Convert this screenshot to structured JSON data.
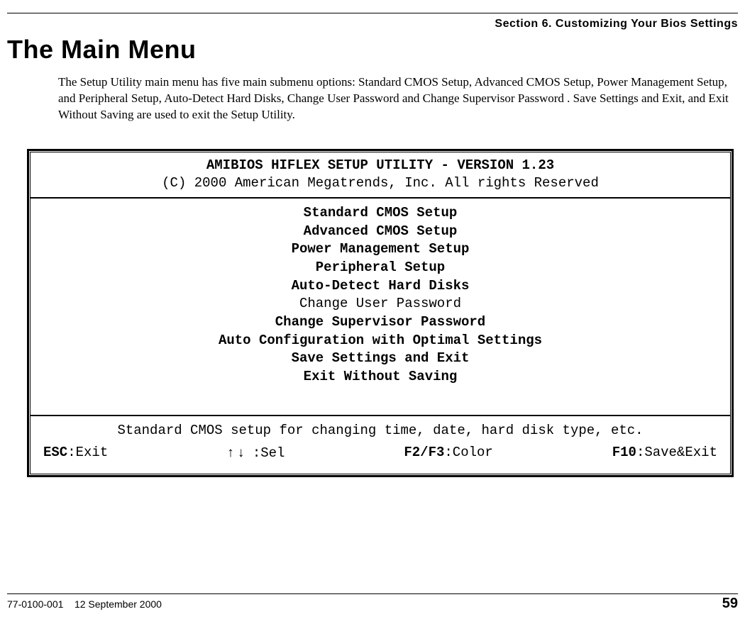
{
  "header": {
    "section": "Section 6. Customizing Your Bios Settings",
    "title": "The Main Menu",
    "intro": "The Setup Utility main menu has five main submenu options: Standard CMOS Setup, Advanced CMOS Setup, Power Management Setup, and Peripheral Setup, Auto-Detect Hard Disks, Change User Password and Change Supervisor Password . Save Settings and Exit, and Exit Without Saving are used to exit the Setup Utility."
  },
  "bios": {
    "title": "AMIBIOS HIFLEX SETUP UTILITY - VERSION 1.23",
    "copyright": "(C) 2000 American Megatrends, Inc. All rights Reserved",
    "menu": {
      "item0": "Standard CMOS Setup",
      "item1": "Advanced CMOS Setup",
      "item2": "Power Management Setup",
      "item3": "Peripheral Setup",
      "item4": "Auto-Detect Hard Disks",
      "item5": "Change User Password",
      "item6": "Change Supervisor Password",
      "item7": "Auto Configuration with Optimal Settings",
      "item8": "Save Settings and Exit",
      "item9": "Exit Without Saving"
    },
    "help": "Standard CMOS setup for changing time, date, hard disk type, etc.",
    "keys": {
      "esc_key": "ESC",
      "esc_label": ":Exit",
      "arrows": "↑ ↓",
      "sel_label": " :Sel",
      "color_key": "F2/F3",
      "color_label": ":Color",
      "save_key": "F10",
      "save_label": ":Save&Exit"
    }
  },
  "footer": {
    "doc_id": "77-0100-001",
    "date": "12 September 2000",
    "page": "59"
  }
}
